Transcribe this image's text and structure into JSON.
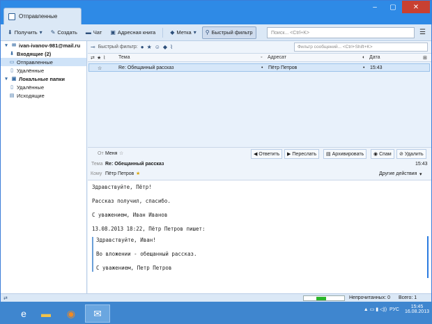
{
  "window": {
    "tab_title": "Отправленные",
    "controls": {
      "minimize": "–",
      "maximize": "▢",
      "close": "✕"
    }
  },
  "toolbar": {
    "get_label": "Получить",
    "compose_label": "Создать",
    "chat_label": "Чат",
    "addressbook_label": "Адресная книга",
    "tag_label": "Метка",
    "quickfilter_label": "Быстрый фильтр",
    "search_placeholder": "Поиск... <Ctrl+K>"
  },
  "folders": {
    "account": "ivan-ivanov-981@mail.ru",
    "inbox": "Входящие (2)",
    "sent": "Отправленные",
    "trash": "Удалённые",
    "local": "Локальные папки",
    "local_trash": "Удалённые",
    "outbox": "Исходящие"
  },
  "quickfilter": {
    "label": "Быстрый фильтр:",
    "search_placeholder": "Фильтр сообщений... <Ctrl+Shift+K>"
  },
  "columns": {
    "subject": "Тема",
    "recipient": "Адресат",
    "date": "Дата"
  },
  "messages": [
    {
      "subject": "Re: Обещанный рассказ",
      "recipient": "Пётр Петров",
      "date": "15:43"
    }
  ],
  "header": {
    "from_label": "От",
    "from_value": "Меня",
    "subject_label": "Тема",
    "subject_value": "Re: Обещанный рассказ",
    "to_label": "Кому",
    "to_value": "Пётр Петров",
    "time": "15:43",
    "reply": "Ответить",
    "forward": "Переслать",
    "archive": "Архивировать",
    "spam": "Спам",
    "delete": "Удалить",
    "other_actions": "Другие действия"
  },
  "body": {
    "line1": "Здравствуйте, Пётр!",
    "line2": "Рассказ получил, спасибо.",
    "line3": "С уважением, Иван Иванов",
    "quote_head": "13.08.2013 18:22, Пётр Петров пишет:",
    "q1": "Здравствуйте, Иван!",
    "q2": "Во вложении - обещанный рассказ.",
    "q3": "С уважением, Петр Петров"
  },
  "status": {
    "unread": "Непрочитанных: 0",
    "total": "Всего: 1"
  },
  "taskbar": {
    "lang": "РУС",
    "time": "15:45",
    "date": "16.08.2013"
  },
  "colors": {
    "accent": "#2e8ae6",
    "selection": "#d6e7f9",
    "progress": "#2bb62b"
  }
}
